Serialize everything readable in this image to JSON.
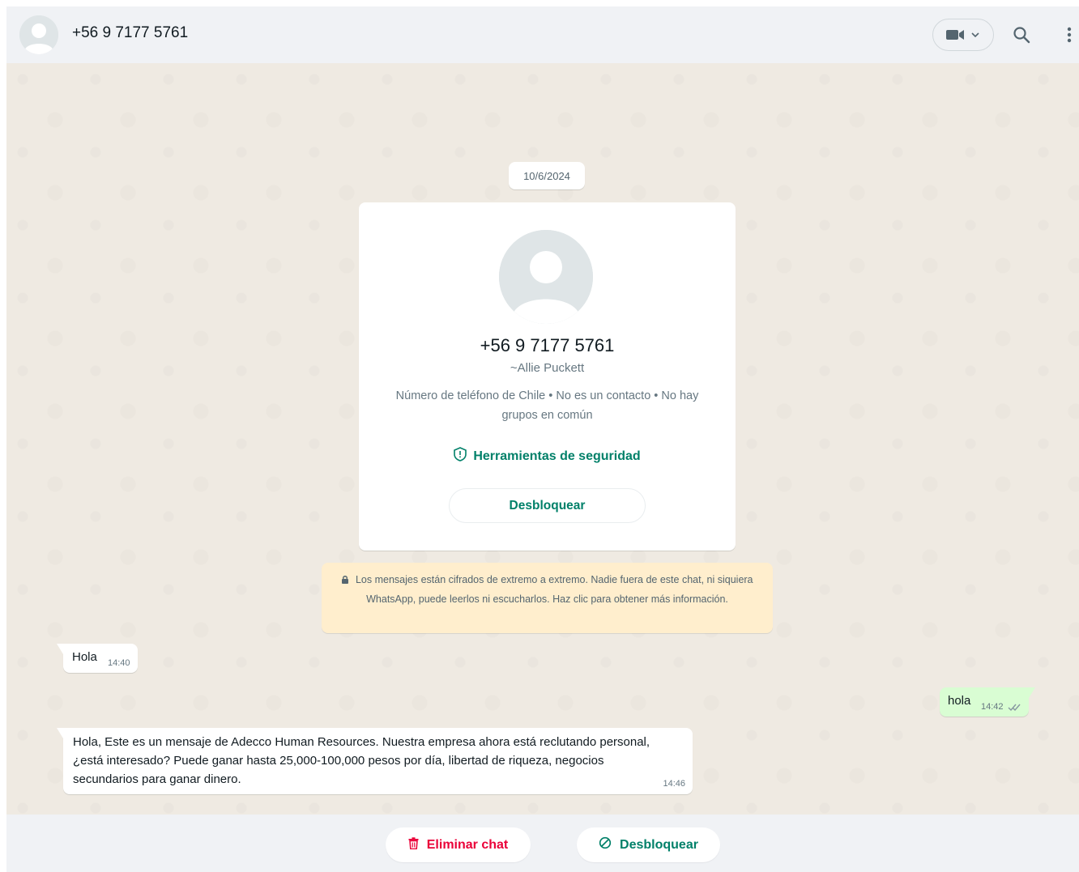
{
  "header": {
    "title": "+56 9 7177 5761",
    "icons": [
      "default-avatar-icon",
      "video-call-icon",
      "chevron-down-icon",
      "search-icon",
      "more-options-icon"
    ]
  },
  "chat": {
    "date_chip": "10/6/2024",
    "contact_card": {
      "phone": "+56 9 7177 5761",
      "name": "~Allie Puckett",
      "info": "Número de teléfono de Chile • No es un contacto • No hay grupos en común",
      "security_label": "Herramientas de seguridad",
      "unblock_label": "Desbloquear"
    },
    "encryption_notice": "Los mensajes están cifrados de extremo a extremo. Nadie fuera de este chat, ni siquiera WhatsApp, puede leerlos ni escucharlos. Haz clic para obtener más información.",
    "messages": [
      {
        "direction": "incoming",
        "text": "Hola",
        "time": "14:40"
      },
      {
        "direction": "outgoing",
        "text": "hola",
        "time": "14:42",
        "status": "read"
      },
      {
        "direction": "incoming",
        "text": "Hola, Este es un mensaje de Adecco Human Resources. Nuestra empresa ahora está reclutando personal, ¿está interesado? Puede ganar hasta 25,000-100,000 pesos por día, libertad de riqueza, negocios secundarios para ganar dinero.",
        "time": "14:46"
      }
    ]
  },
  "footer": {
    "delete_label": "Eliminar chat",
    "unblock_label": "Desbloquear"
  },
  "colors": {
    "accent_green": "#008069",
    "danger_red": "#ea0038",
    "chat_background": "#efeae2",
    "outgoing_bubble": "#d9fdd3",
    "notice_background": "#ffeecd",
    "read_ticks": "#8696a0"
  }
}
